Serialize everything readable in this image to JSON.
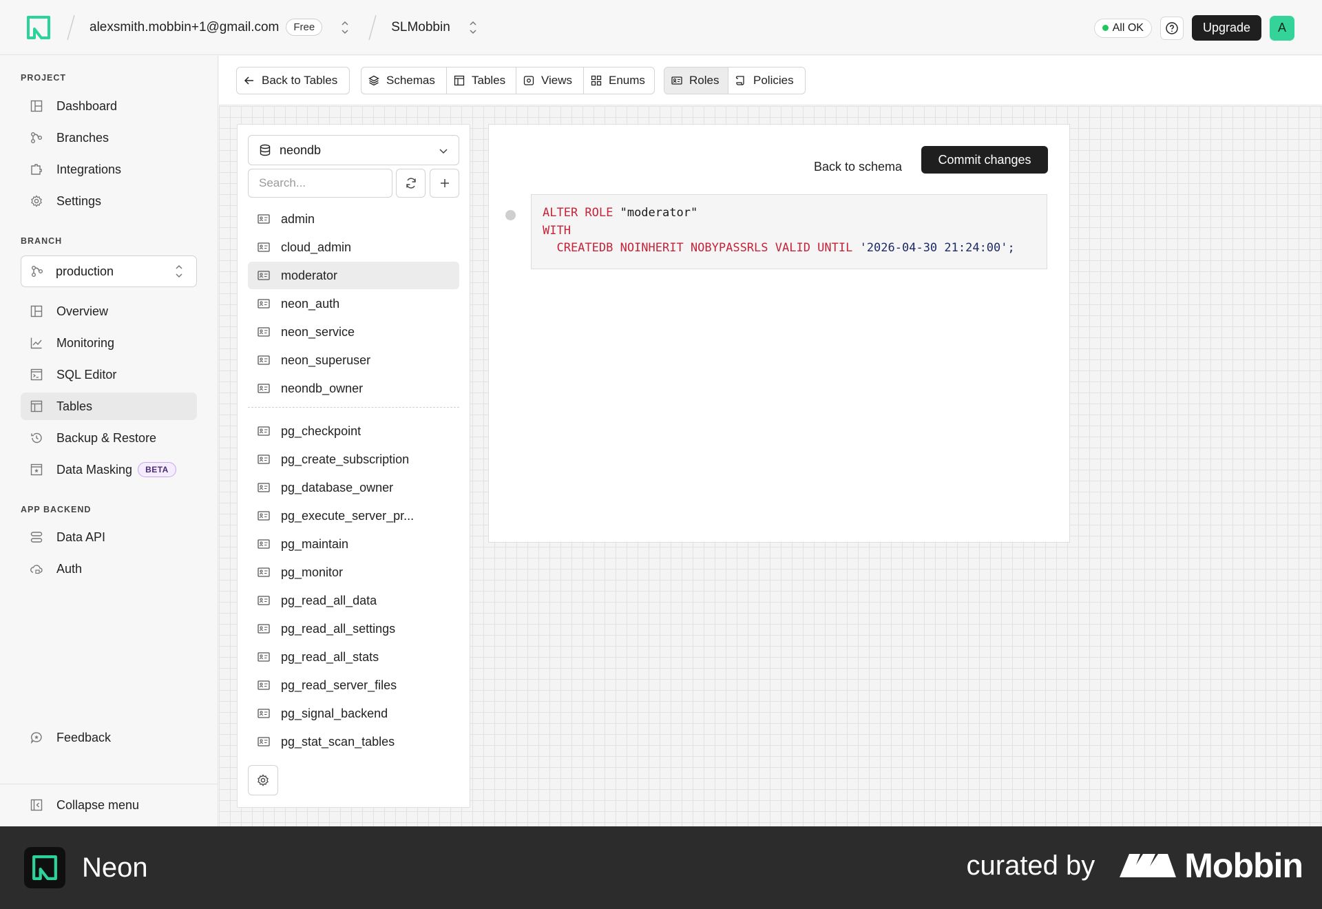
{
  "topbar": {
    "account": "alexsmith.mobbin+1@gmail.com",
    "plan": "Free",
    "project": "SLMobbin",
    "status": "All OK",
    "upgrade": "Upgrade",
    "avatar": "A"
  },
  "sidebar": {
    "project_label": "PROJECT",
    "project_items": [
      "Dashboard",
      "Branches",
      "Integrations",
      "Settings"
    ],
    "branch_label": "BRANCH",
    "branch": "production",
    "branch_items": [
      "Overview",
      "Monitoring",
      "SQL Editor",
      "Tables",
      "Backup & Restore",
      "Data Masking"
    ],
    "beta": "BETA",
    "backend_label": "APP BACKEND",
    "backend_items": [
      "Data API",
      "Auth"
    ],
    "feedback": "Feedback",
    "collapse": "Collapse menu"
  },
  "toolbar": {
    "back": "Back to Tables",
    "schemas": "Schemas",
    "tables": "Tables",
    "views": "Views",
    "enums": "Enums",
    "roles": "Roles",
    "policies": "Policies"
  },
  "roles_panel": {
    "database": "neondb",
    "search_placeholder": "Search...",
    "roles": [
      "admin",
      "cloud_admin",
      "moderator",
      "neon_auth",
      "neon_service",
      "neon_superuser",
      "neondb_owner"
    ],
    "system_roles": [
      "pg_checkpoint",
      "pg_create_subscription",
      "pg_database_owner",
      "pg_execute_server_pr...",
      "pg_maintain",
      "pg_monitor",
      "pg_read_all_data",
      "pg_read_all_settings",
      "pg_read_all_stats",
      "pg_read_server_files",
      "pg_signal_backend",
      "pg_stat_scan_tables"
    ]
  },
  "editor": {
    "back_to_schema": "Back to schema",
    "commit": "Commit changes",
    "code": {
      "l1_kw": "ALTER ROLE",
      "l1_name": " \"moderator\"",
      "l2_kw": "WITH",
      "l3_kw": "  CREATEDB NOINHERIT NOBYPASSRLS VALID UNTIL",
      "l3_val": " '2026-04-30 21:24:00';"
    }
  },
  "footer": {
    "brand": "Neon",
    "curated": "curated by",
    "mobbin": "Mobbin"
  },
  "colors": {
    "accent": "#34d399",
    "keyword": "#c4243a",
    "dark_button": "#1f1f1f"
  }
}
